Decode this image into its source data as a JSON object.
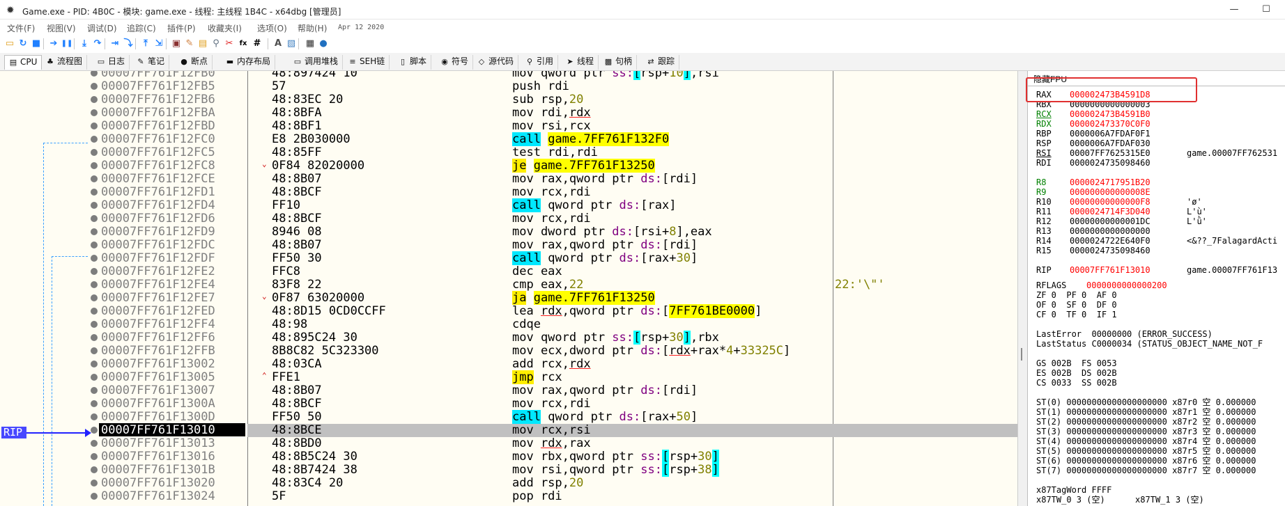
{
  "window": {
    "title": "Game.exe - PID: 4B0C - 模块: game.exe - 线程: 主线程 1B4C - x64dbg [管理员]",
    "minimize": "—",
    "maximize": "☐"
  },
  "menu": {
    "items": [
      "文件(F)",
      "视图(V)",
      "调试(D)",
      "追踪(C)",
      "插件(P)",
      "收藏夹(I)",
      "选项(O)",
      "帮助(H)"
    ],
    "date": "Apr 12 2020"
  },
  "toolbar": {
    "icons": [
      {
        "name": "open-icon",
        "glyph": "▭",
        "color": "#e0a020"
      },
      {
        "name": "restart-icon",
        "glyph": "↻",
        "color": "#2080ff"
      },
      {
        "name": "stop-icon",
        "glyph": "■",
        "color": "#2080ff"
      },
      {
        "name": "run-icon",
        "glyph": "➔",
        "color": "#2080ff"
      },
      {
        "name": "pause-icon",
        "glyph": "❚❚",
        "color": "#2080ff"
      },
      {
        "name": "step-into-icon",
        "glyph": "⤓",
        "color": "#2080ff"
      },
      {
        "name": "step-over-icon",
        "glyph": "↷",
        "color": "#2080ff"
      },
      {
        "name": "trace-into-icon",
        "glyph": "⇥",
        "color": "#2080ff"
      },
      {
        "name": "trace-over-icon",
        "glyph": "⤵",
        "color": "#2080ff"
      },
      {
        "name": "execute-till-return-icon",
        "glyph": "⤒",
        "color": "#2080ff"
      },
      {
        "name": "run-to-user-code-icon",
        "glyph": "⇲",
        "color": "#2080ff"
      },
      {
        "name": "scylla-icon",
        "glyph": "▣",
        "color": "#8a3030"
      },
      {
        "name": "patch-icon",
        "glyph": "✎",
        "color": "#d08040"
      },
      {
        "name": "comments-icon",
        "glyph": "▤",
        "color": "#e0a020"
      },
      {
        "name": "labels-icon",
        "glyph": "⚲",
        "color": "#607080"
      },
      {
        "name": "bookmarks-icon",
        "glyph": "✂",
        "color": "#e02020"
      },
      {
        "name": "functions-icon",
        "glyph": "fx",
        "color": "#000000"
      },
      {
        "name": "hash-icon",
        "glyph": "#",
        "color": "#000000"
      },
      {
        "name": "font-icon",
        "glyph": "A",
        "color": "#505050"
      },
      {
        "name": "find-strings-icon",
        "glyph": "▧",
        "color": "#4080c0"
      },
      {
        "name": "calculator-icon",
        "glyph": "▦",
        "color": "#303030"
      },
      {
        "name": "globe-icon",
        "glyph": "●",
        "color": "#2070c0"
      }
    ]
  },
  "tabs": [
    {
      "name": "tab-cpu",
      "icon": "▤",
      "label": "CPU"
    },
    {
      "name": "tab-graph",
      "icon": "♣",
      "label": "流程图"
    },
    {
      "name": "tab-log",
      "icon": "▭",
      "label": "日志"
    },
    {
      "name": "tab-notes",
      "icon": "✎",
      "label": "笔记"
    },
    {
      "name": "tab-breakpoints",
      "icon": "●",
      "label": "断点"
    },
    {
      "name": "tab-memory-map",
      "icon": "▬",
      "label": "内存布局"
    },
    {
      "name": "tab-call-stack",
      "icon": "▭",
      "label": "调用堆栈"
    },
    {
      "name": "tab-seh",
      "icon": "≡",
      "label": "SEH链"
    },
    {
      "name": "tab-script",
      "icon": "▯",
      "label": "脚本"
    },
    {
      "name": "tab-symbols",
      "icon": "◉",
      "label": "符号"
    },
    {
      "name": "tab-source",
      "icon": "◇",
      "label": "源代码"
    },
    {
      "name": "tab-references",
      "icon": "⚲",
      "label": "引用"
    },
    {
      "name": "tab-threads",
      "icon": "➤",
      "label": "线程"
    },
    {
      "name": "tab-handles",
      "icon": "▩",
      "label": "句柄"
    },
    {
      "name": "tab-trace",
      "icon": "⇄",
      "label": "跟踪"
    }
  ],
  "disasm": {
    "rip_label": "RIP",
    "rows": [
      {
        "addr": "00007FF761F12FB0",
        "bytes": "48:897424 10",
        "asm": [
          [
            "mov qword ptr ",
            ""
          ],
          [
            "ss:",
            "seg"
          ],
          [
            "[",
            "brk"
          ],
          [
            "rsp+",
            ""
          ],
          [
            "10",
            "num"
          ],
          [
            "]",
            "brk"
          ],
          [
            ",rsi",
            ""
          ]
        ],
        "cmt": "",
        "mark": ""
      },
      {
        "addr": "00007FF761F12FB5",
        "bytes": "57",
        "asm": [
          [
            "push rdi",
            ""
          ]
        ],
        "cmt": "",
        "mark": ""
      },
      {
        "addr": "00007FF761F12FB6",
        "bytes": "48:83EC 20",
        "asm": [
          [
            "sub rsp,",
            ""
          ],
          [
            "20",
            "num"
          ]
        ],
        "cmt": "",
        "mark": ""
      },
      {
        "addr": "00007FF761F12FBA",
        "bytes": "48:8BFA",
        "asm": [
          [
            "mov rdi,",
            ""
          ],
          [
            "rdx",
            "rrd"
          ]
        ],
        "cmt": "",
        "mark": ""
      },
      {
        "addr": "00007FF761F12FBD",
        "bytes": "48:8BF1",
        "asm": [
          [
            "mov rsi,rcx",
            ""
          ]
        ],
        "cmt": "",
        "mark": ""
      },
      {
        "addr": "00007FF761F12FC0",
        "bytes": "E8 2B030000",
        "asm": [
          [
            "call",
            "hl-call"
          ],
          [
            " ",
            ""
          ],
          [
            "game.7FF761F132F0",
            "hl-tgt"
          ]
        ],
        "cmt": "",
        "mark": ""
      },
      {
        "addr": "00007FF761F12FC5",
        "bytes": "48:85FF",
        "asm": [
          [
            "test rdi,rdi",
            ""
          ]
        ],
        "cmt": "",
        "mark": ""
      },
      {
        "addr": "00007FF761F12FC8",
        "bytes": "0F84 82020000",
        "asm": [
          [
            "je",
            "hl-jmp"
          ],
          [
            " ",
            ""
          ],
          [
            "game.7FF761F13250",
            "hl-tgt"
          ]
        ],
        "cmt": "",
        "mark": "⌄"
      },
      {
        "addr": "00007FF761F12FCE",
        "bytes": "48:8B07",
        "asm": [
          [
            "mov rax,qword ptr ",
            ""
          ],
          [
            "ds:",
            "seg"
          ],
          [
            "[rdi]",
            ""
          ]
        ],
        "cmt": "",
        "mark": ""
      },
      {
        "addr": "00007FF761F12FD1",
        "bytes": "48:8BCF",
        "asm": [
          [
            "mov rcx,rdi",
            ""
          ]
        ],
        "cmt": "",
        "mark": ""
      },
      {
        "addr": "00007FF761F12FD4",
        "bytes": "FF10",
        "asm": [
          [
            "call",
            "hl-call"
          ],
          [
            " qword ptr ",
            ""
          ],
          [
            "ds:",
            "seg"
          ],
          [
            "[rax]",
            ""
          ]
        ],
        "cmt": "",
        "mark": ""
      },
      {
        "addr": "00007FF761F12FD6",
        "bytes": "48:8BCF",
        "asm": [
          [
            "mov rcx,rdi",
            ""
          ]
        ],
        "cmt": "",
        "mark": ""
      },
      {
        "addr": "00007FF761F12FD9",
        "bytes": "8946 08",
        "asm": [
          [
            "mov dword ptr ",
            ""
          ],
          [
            "ds:",
            "seg"
          ],
          [
            "[rsi+",
            ""
          ],
          [
            "8",
            "num"
          ],
          [
            "],eax",
            ""
          ]
        ],
        "cmt": "",
        "mark": ""
      },
      {
        "addr": "00007FF761F12FDC",
        "bytes": "48:8B07",
        "asm": [
          [
            "mov rax,qword ptr ",
            ""
          ],
          [
            "ds:",
            "seg"
          ],
          [
            "[rdi]",
            ""
          ]
        ],
        "cmt": "",
        "mark": ""
      },
      {
        "addr": "00007FF761F12FDF",
        "bytes": "FF50 30",
        "asm": [
          [
            "call",
            "hl-call"
          ],
          [
            " qword ptr ",
            ""
          ],
          [
            "ds:",
            "seg"
          ],
          [
            "[rax+",
            ""
          ],
          [
            "30",
            "num"
          ],
          [
            "]",
            ""
          ]
        ],
        "cmt": "",
        "mark": ""
      },
      {
        "addr": "00007FF761F12FE2",
        "bytes": "FFC8",
        "asm": [
          [
            "dec eax",
            ""
          ]
        ],
        "cmt": "",
        "mark": ""
      },
      {
        "addr": "00007FF761F12FE4",
        "bytes": "83F8 22",
        "asm": [
          [
            "cmp eax,",
            ""
          ],
          [
            "22",
            "num"
          ]
        ],
        "cmt": "22:'\\\"'",
        "mark": ""
      },
      {
        "addr": "00007FF761F12FE7",
        "bytes": "0F87 63020000",
        "asm": [
          [
            "ja",
            "hl-jmp"
          ],
          [
            " ",
            ""
          ],
          [
            "game.7FF761F13250",
            "hl-tgt"
          ]
        ],
        "cmt": "",
        "mark": "⌄"
      },
      {
        "addr": "00007FF761F12FED",
        "bytes": "48:8D15 0CD0CCFF",
        "asm": [
          [
            "lea ",
            ""
          ],
          [
            "rdx",
            "rrd"
          ],
          [
            ",qword ptr ",
            ""
          ],
          [
            "ds:",
            "seg"
          ],
          [
            "[",
            ""
          ],
          [
            "7FF761BE0000",
            "hl-tgt"
          ],
          [
            "]",
            ""
          ]
        ],
        "cmt": "",
        "mark": ""
      },
      {
        "addr": "00007FF761F12FF4",
        "bytes": "48:98",
        "asm": [
          [
            "cdqe",
            ""
          ]
        ],
        "cmt": "",
        "mark": ""
      },
      {
        "addr": "00007FF761F12FF6",
        "bytes": "48:895C24 30",
        "asm": [
          [
            "mov qword ptr ",
            ""
          ],
          [
            "ss:",
            "seg"
          ],
          [
            "[",
            "brk"
          ],
          [
            "rsp+",
            ""
          ],
          [
            "30",
            "num"
          ],
          [
            "]",
            "brk"
          ],
          [
            ",rbx",
            ""
          ]
        ],
        "cmt": "",
        "mark": ""
      },
      {
        "addr": "00007FF761F12FFB",
        "bytes": "8B8C82 5C323300",
        "asm": [
          [
            "mov ecx,dword ptr ",
            ""
          ],
          [
            "ds:",
            "seg"
          ],
          [
            "[",
            ""
          ],
          [
            "rdx",
            "rrd"
          ],
          [
            "+rax*",
            ""
          ],
          [
            "4",
            "num"
          ],
          [
            "+",
            ""
          ],
          [
            "33325C",
            "num"
          ],
          [
            "]",
            ""
          ]
        ],
        "cmt": "",
        "mark": ""
      },
      {
        "addr": "00007FF761F13002",
        "bytes": "48:03CA",
        "asm": [
          [
            "add rcx,",
            ""
          ],
          [
            "rdx",
            "rrd"
          ]
        ],
        "cmt": "",
        "mark": ""
      },
      {
        "addr": "00007FF761F13005",
        "bytes": "FFE1",
        "asm": [
          [
            "jmp",
            "hl-jmp"
          ],
          [
            " rcx",
            ""
          ]
        ],
        "cmt": "",
        "mark": "⌃"
      },
      {
        "addr": "00007FF761F13007",
        "bytes": "48:8B07",
        "asm": [
          [
            "mov rax,qword ptr ",
            ""
          ],
          [
            "ds:",
            "seg"
          ],
          [
            "[rdi]",
            ""
          ]
        ],
        "cmt": "",
        "mark": ""
      },
      {
        "addr": "00007FF761F1300A",
        "bytes": "48:8BCF",
        "asm": [
          [
            "mov rcx,rdi",
            ""
          ]
        ],
        "cmt": "",
        "mark": ""
      },
      {
        "addr": "00007FF761F1300D",
        "bytes": "FF50 50",
        "asm": [
          [
            "call",
            "hl-call"
          ],
          [
            " qword ptr ",
            ""
          ],
          [
            "ds:",
            "seg"
          ],
          [
            "[rax+",
            ""
          ],
          [
            "50",
            "num"
          ],
          [
            "]",
            ""
          ]
        ],
        "cmt": "",
        "mark": ""
      },
      {
        "addr": "00007FF761F13010",
        "bytes": "48:8BCE",
        "asm": [
          [
            "mov rcx,rsi",
            ""
          ]
        ],
        "cmt": "",
        "mark": "",
        "current": true
      },
      {
        "addr": "00007FF761F13013",
        "bytes": "48:8BD0",
        "asm": [
          [
            "mov ",
            ""
          ],
          [
            "rdx",
            "rrd"
          ],
          [
            ",rax",
            ""
          ]
        ],
        "cmt": "",
        "mark": ""
      },
      {
        "addr": "00007FF761F13016",
        "bytes": "48:8B5C24 30",
        "asm": [
          [
            "mov rbx,qword ptr ",
            ""
          ],
          [
            "ss:",
            "seg"
          ],
          [
            "[",
            "brk"
          ],
          [
            "rsp+",
            ""
          ],
          [
            "30",
            "num"
          ],
          [
            "]",
            "brk"
          ]
        ],
        "cmt": "",
        "mark": ""
      },
      {
        "addr": "00007FF761F1301B",
        "bytes": "48:8B7424 38",
        "asm": [
          [
            "mov rsi,qword ptr ",
            ""
          ],
          [
            "ss:",
            "seg"
          ],
          [
            "[",
            "brk"
          ],
          [
            "rsp+",
            ""
          ],
          [
            "38",
            "num"
          ],
          [
            "]",
            "brk"
          ]
        ],
        "cmt": "",
        "mark": ""
      },
      {
        "addr": "00007FF761F13020",
        "bytes": "48:83C4 20",
        "asm": [
          [
            "add rsp,",
            ""
          ],
          [
            "20",
            "num"
          ]
        ],
        "cmt": "",
        "mark": ""
      },
      {
        "addr": "00007FF761F13024",
        "bytes": "5F",
        "asm": [
          [
            "pop rdi",
            ""
          ]
        ],
        "cmt": "",
        "mark": ""
      }
    ]
  },
  "registers": {
    "header": "隐藏FPU",
    "colors": {
      "changed": "#ff0000",
      "normal": "#000000",
      "green": "#008000"
    },
    "rows": [
      {
        "n": "RAX",
        "v": "000002473B4591D8",
        "c": "changed",
        "nc": "normal",
        "d": ""
      },
      {
        "n": "RBX",
        "v": "0000000000000003",
        "c": "normal",
        "nc": "normal",
        "d": ""
      },
      {
        "n": "RCX",
        "v": "000002473B4591B0",
        "c": "changed",
        "nc": "green",
        "d": "",
        "u": true
      },
      {
        "n": "RDX",
        "v": "00000247337 0C0F0",
        "c": "changed",
        "nc": "green",
        "d": ""
      },
      {
        "n": "RBP",
        "v": "0000006A7FDAF0F1",
        "c": "normal",
        "nc": "normal",
        "d": ""
      },
      {
        "n": "RSP",
        "v": "0000006A7FDAF030",
        "c": "normal",
        "nc": "normal",
        "d": ""
      },
      {
        "n": "RSI",
        "v": "00007FF7625315E0",
        "c": "normal",
        "nc": "normal",
        "d": "game.00007FF762531",
        "u": true
      },
      {
        "n": "RDI",
        "v": "0000024735098460",
        "c": "normal",
        "nc": "normal",
        "d": ""
      },
      {
        "n": "",
        "v": "",
        "c": "normal",
        "nc": "normal",
        "d": ""
      },
      {
        "n": "R8",
        "v": "0000024717951B20",
        "c": "changed",
        "nc": "green",
        "d": ""
      },
      {
        "n": "R9",
        "v": "000000000000008E",
        "c": "changed",
        "nc": "green",
        "d": ""
      },
      {
        "n": "R10",
        "v": "00000000000000F8",
        "c": "changed",
        "nc": "normal",
        "d": "'ø'"
      },
      {
        "n": "R11",
        "v": "0000024714F3D040",
        "c": "changed",
        "nc": "normal",
        "d": "L'ù'"
      },
      {
        "n": "R12",
        "v": "00000000000001DC",
        "c": "normal",
        "nc": "normal",
        "d": "L'ǜ'"
      },
      {
        "n": "R13",
        "v": "0000000000000000",
        "c": "normal",
        "nc": "normal",
        "d": ""
      },
      {
        "n": "R14",
        "v": "0000024722E640F0",
        "c": "normal",
        "nc": "normal",
        "d": "<&??_7FalagardActi"
      },
      {
        "n": "R15",
        "v": "0000024735098460",
        "c": "normal",
        "nc": "normal",
        "d": ""
      },
      {
        "n": "",
        "v": "",
        "c": "normal",
        "nc": "normal",
        "d": ""
      },
      {
        "n": "RIP",
        "v": "00007FF761F13010",
        "c": "changed",
        "nc": "normal",
        "d": "game.00007FF761F13"
      }
    ],
    "rflags_label": "RFLAGS",
    "rflags_value": "0000000000000200",
    "flags": [
      "ZF 0  PF 0  AF 0",
      "OF 0  SF 0  DF 0",
      "CF 0  TF 0  IF 1"
    ],
    "last_error": "LastError  00000000 (ERROR_SUCCESS)",
    "last_status": "LastStatus C0000034 (STATUS_OBJECT_NAME_NOT_F",
    "segs": [
      "GS 002B  FS 0053",
      "ES 002B  DS 002B",
      "CS 0033  SS 002B"
    ],
    "st": [
      "ST(0) 00000000000000000000 x87r0 空 0.000000",
      "ST(1) 00000000000000000000 x87r1 空 0.000000",
      "ST(2) 00000000000000000000 x87r2 空 0.000000",
      "ST(3) 00000000000000000000 x87r3 空 0.000000",
      "ST(4) 00000000000000000000 x87r4 空 0.000000",
      "ST(5) 00000000000000000000 x87r5 空 0.000000",
      "ST(6) 00000000000000000000 x87r6 空 0.000000",
      "ST(7) 00000000000000000000 x87r7 空 0.000000"
    ],
    "tagword": "x87TagWord FFFF",
    "tagword2": "x87TW_0 3 (空)      x87TW_1 3 (空)"
  }
}
